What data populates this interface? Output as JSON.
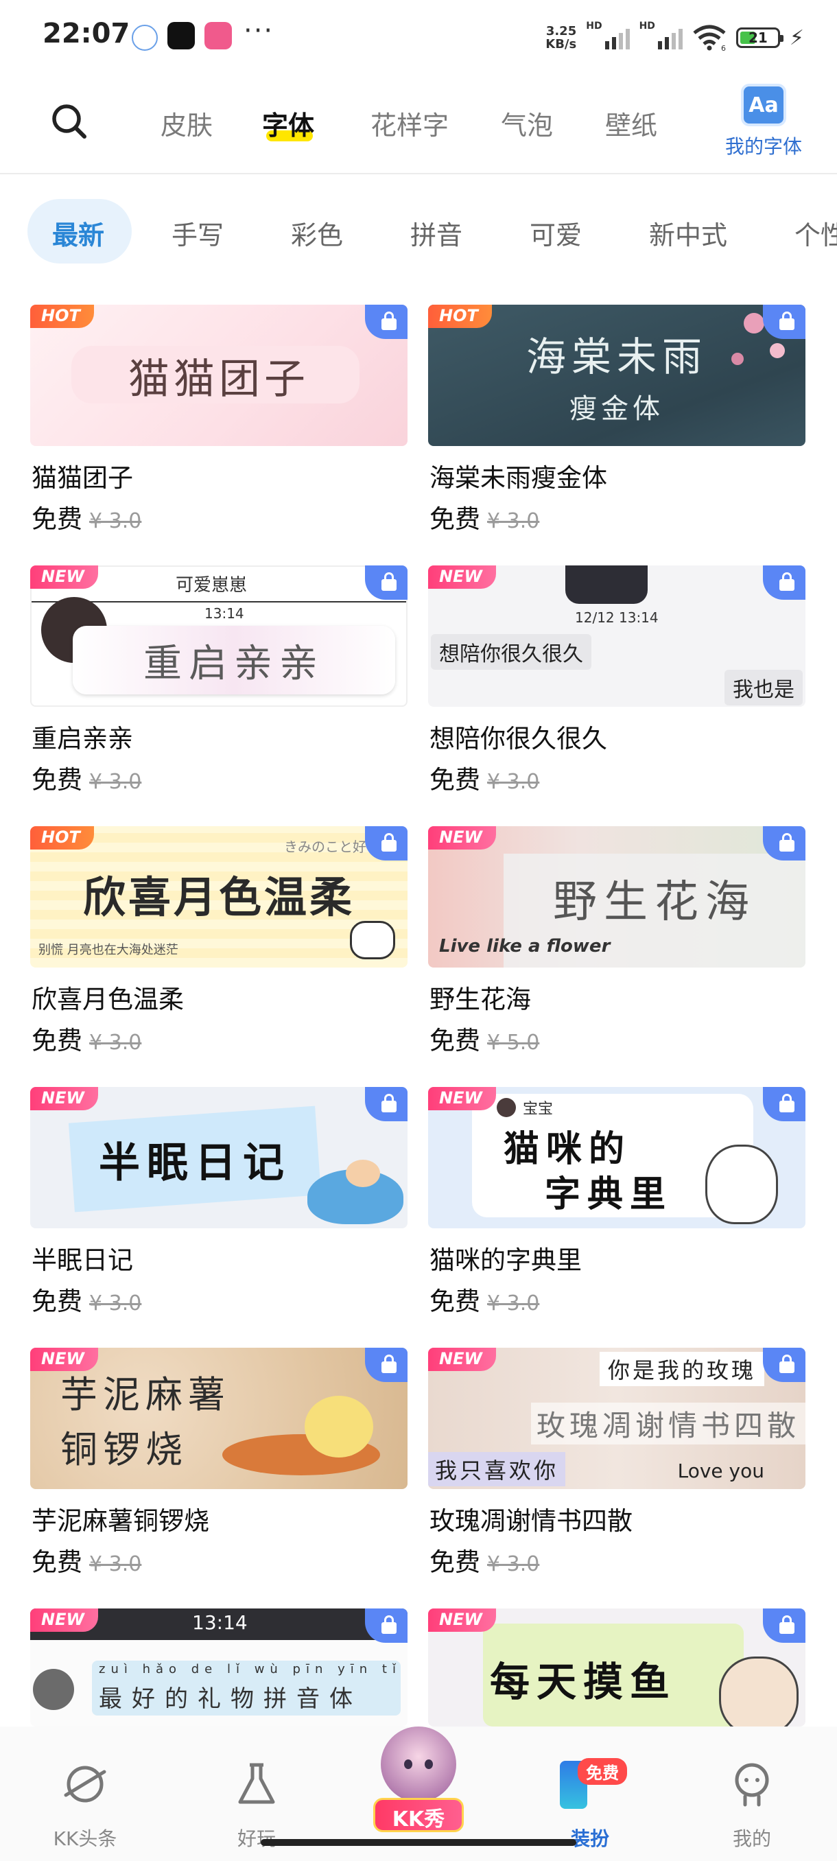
{
  "status": {
    "time": "22:07",
    "more": "···",
    "net_speed_value": "3.25",
    "net_speed_unit": "KB/s",
    "hd1": "HD",
    "hd2": "HD",
    "wifi_sub": "6",
    "battery": "21"
  },
  "top_tabs": {
    "search_icon": "search-icon",
    "items": [
      "皮肤",
      "字体",
      "花样字",
      "气泡",
      "壁纸"
    ],
    "active": "字体",
    "my_font_badge": "Aa",
    "my_font_label": "我的字体"
  },
  "categories": {
    "items": [
      "最新",
      "手写",
      "彩色",
      "拼音",
      "可爱",
      "新中式",
      "个性"
    ],
    "active": "最新"
  },
  "accent": "#2a86d6",
  "cards": [
    {
      "tag": "HOT",
      "title": "猫猫团子",
      "price": "免费",
      "original": "¥ 3.0",
      "art": "猫猫团子"
    },
    {
      "tag": "HOT",
      "title": "海棠未雨瘦金体",
      "price": "免费",
      "original": "¥ 3.0",
      "art": "海棠未雨",
      "art2": "瘦金体"
    },
    {
      "tag": "NEW",
      "title": "重启亲亲",
      "price": "免费",
      "original": "¥ 3.0",
      "art": "重启亲亲",
      "art_top": "可爱崽崽",
      "art_time": "13:14"
    },
    {
      "tag": "NEW",
      "title": "想陪你很久很久",
      "price": "免费",
      "original": "¥ 3.0",
      "art": "想陪你很久很久",
      "art_reply": "我也是",
      "art_time": "12/12 13:14"
    },
    {
      "tag": "HOT",
      "title": "欣喜月色温柔",
      "price": "免费",
      "original": "¥ 3.0",
      "art": "欣喜月色温柔",
      "art_sub": "别慌 月亮也在大海处迷茫",
      "art_corner": "きみのこと好き"
    },
    {
      "tag": "NEW",
      "title": "野生花海",
      "price": "免费",
      "original": "¥ 5.0",
      "art": "野生花海",
      "art_sub": "Live like a flower"
    },
    {
      "tag": "NEW",
      "title": "半眠日记",
      "price": "免费",
      "original": "¥ 3.0",
      "art": "半眠日记"
    },
    {
      "tag": "NEW",
      "title": "猫咪的字典里",
      "price": "免费",
      "original": "¥ 3.0",
      "art": "猫咪的",
      "art2": "字典里",
      "art_user": "宝宝"
    },
    {
      "tag": "NEW",
      "title": "芋泥麻薯铜锣烧",
      "price": "免费",
      "original": "¥ 3.0",
      "art": "芋泥麻薯",
      "art2": "铜锣烧"
    },
    {
      "tag": "NEW",
      "title": "玫瑰凋谢情书四散",
      "price": "免费",
      "original": "¥ 3.0",
      "art": "玫瑰凋谢情书四散",
      "art_top": "你是我的玫瑰",
      "art_left": "我只喜欢你",
      "art_right": "Love you"
    },
    {
      "tag": "NEW",
      "title": "",
      "price": "",
      "original": "",
      "art_time": "13:14",
      "art_pinyin": "zuì hǎo de lǐ wù pīn yīn tǐ",
      "art": "最好的礼物拼音体"
    },
    {
      "tag": "NEW",
      "title": "",
      "price": "",
      "original": "",
      "art": "每天摸鱼"
    }
  ],
  "bottom_nav": [
    {
      "label": "KK头条",
      "icon": "planet-icon"
    },
    {
      "label": "好玩",
      "icon": "flask-icon"
    },
    {
      "label": "KK秀",
      "icon": "avatar-mascot-icon"
    },
    {
      "label": "装扮",
      "icon": "dress-up-icon",
      "badge": "免费"
    },
    {
      "label": "我的",
      "icon": "profile-icon"
    }
  ],
  "bottom_active": "装扮"
}
